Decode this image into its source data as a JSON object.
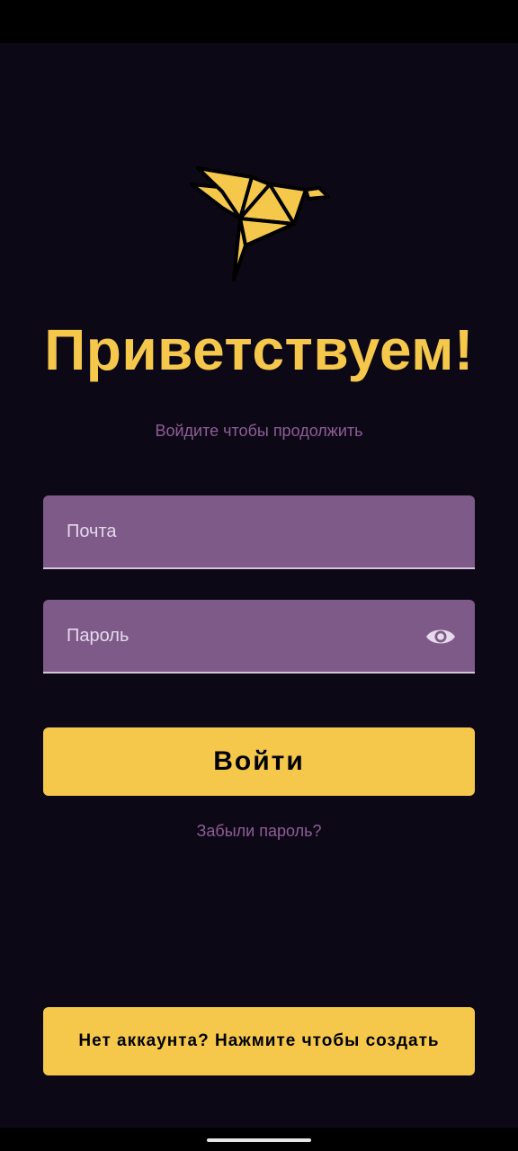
{
  "welcome": {
    "title": "Приветствуем!",
    "subtitle": "Войдите чтобы продолжить"
  },
  "form": {
    "email_placeholder": "Почта",
    "password_placeholder": "Пароль",
    "password_toggle_icon": "eye-icon"
  },
  "actions": {
    "login_label": "Войти",
    "forgot_password_label": "Забыли пароль?",
    "signup_label": "Нет аккаунта? Нажмите чтобы создать"
  },
  "logo": {
    "icon": "origami-bird-icon"
  },
  "colors": {
    "background": "#0d0816",
    "accent": "#f5c84c",
    "field": "#7e5a89",
    "muted_text": "#8f5d97"
  }
}
